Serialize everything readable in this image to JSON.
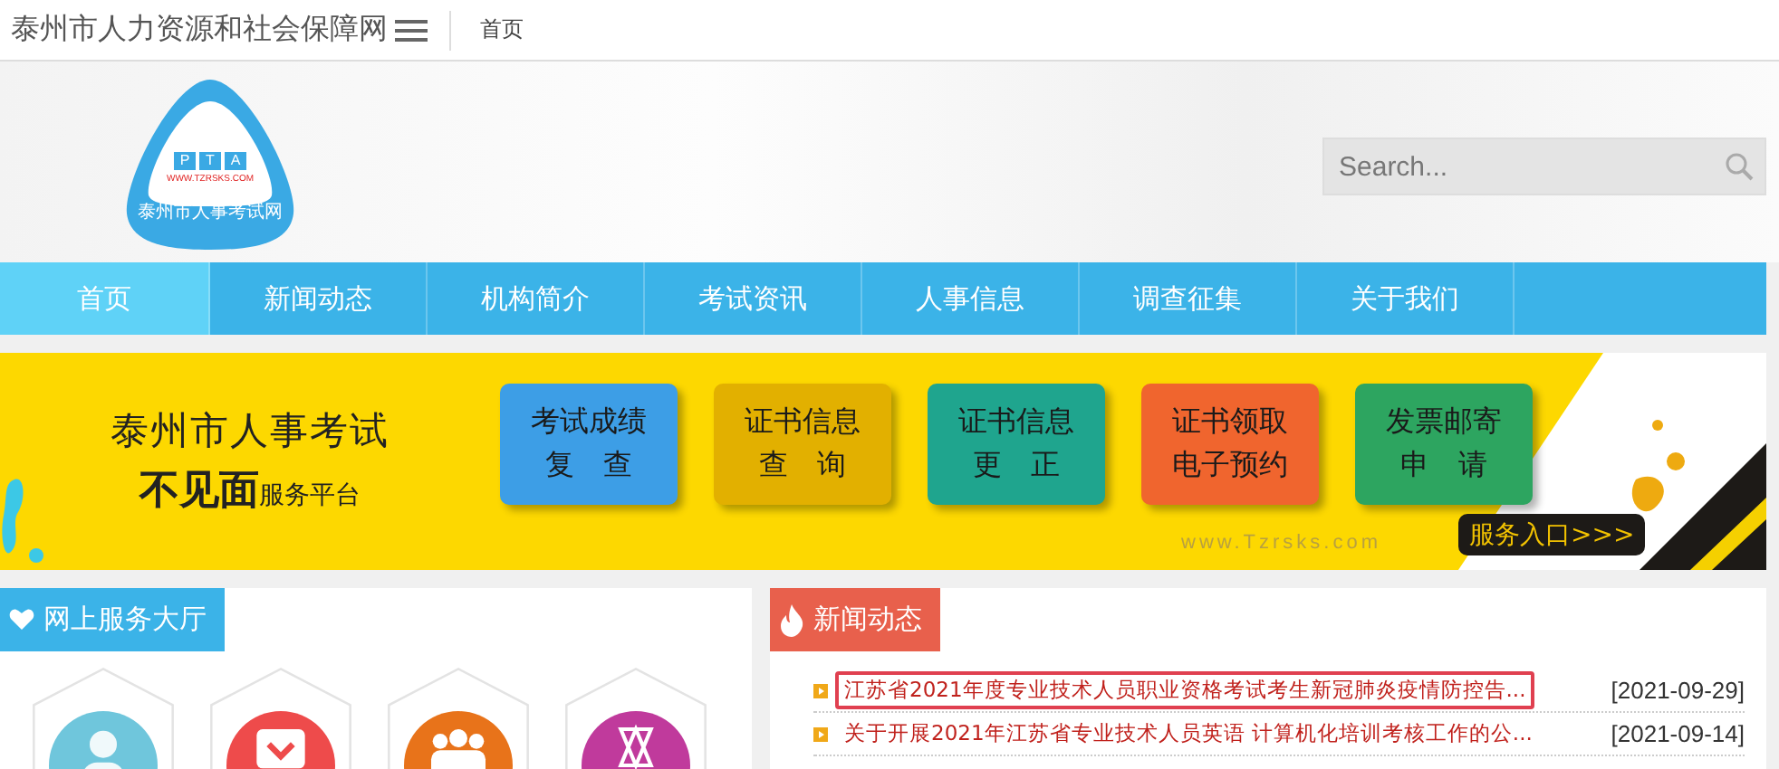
{
  "top_bar": {
    "site_title": "泰州市人力资源和社会保障网",
    "breadcrumb": "首页"
  },
  "logo": {
    "letters": [
      "P",
      "T",
      "A"
    ],
    "url": "WWW.TZRSKS.COM",
    "name": "泰州市人事考试网"
  },
  "search": {
    "placeholder": "Search..."
  },
  "nav": [
    {
      "label": "首页",
      "selected": true
    },
    {
      "label": "新闻动态",
      "selected": false
    },
    {
      "label": "机构简介",
      "selected": false
    },
    {
      "label": "考试资讯",
      "selected": false
    },
    {
      "label": "人事信息",
      "selected": false
    },
    {
      "label": "调查征集",
      "selected": false
    },
    {
      "label": "关于我们",
      "selected": false
    }
  ],
  "banner": {
    "title": "泰州市人事考试",
    "bold_part": "不见面",
    "subtitle": "服务平台",
    "site": "www.Tzrsks.com",
    "entry": "服务入口>>>",
    "tiles": [
      {
        "line1": "考试成绩",
        "line2": "复　查",
        "color": "#3d9ee6"
      },
      {
        "line1": "证书信息",
        "line2": "查　询",
        "color": "#e2b000"
      },
      {
        "line1": "证书信息",
        "line2": "更　正",
        "color": "#1fa58e"
      },
      {
        "line1": "证书领取",
        "line2": "电子预约",
        "color": "#f0652e"
      },
      {
        "line1": "发票邮寄",
        "line2": "申　请",
        "color": "#2da560"
      }
    ]
  },
  "service_hall": {
    "title": "网上服务大厅",
    "icons": [
      {
        "kind": "person",
        "color": "#6fc6dc"
      },
      {
        "kind": "pocket",
        "color": "#ee4b4b"
      },
      {
        "kind": "group",
        "color": "#e8731a"
      },
      {
        "kind": "star",
        "color": "#c03a9c"
      }
    ]
  },
  "news": {
    "title": "新闻动态",
    "items": [
      {
        "title": "江苏省2021年度专业技术人员职业资格考试考生新冠肺炎疫情防控告...",
        "date": "[2021-09-29]",
        "selected": true
      },
      {
        "title": "关于开展2021年江苏省专业技术人员英语 计算机化培训考核工作的公...",
        "date": "[2021-09-14]",
        "selected": false
      }
    ]
  }
}
